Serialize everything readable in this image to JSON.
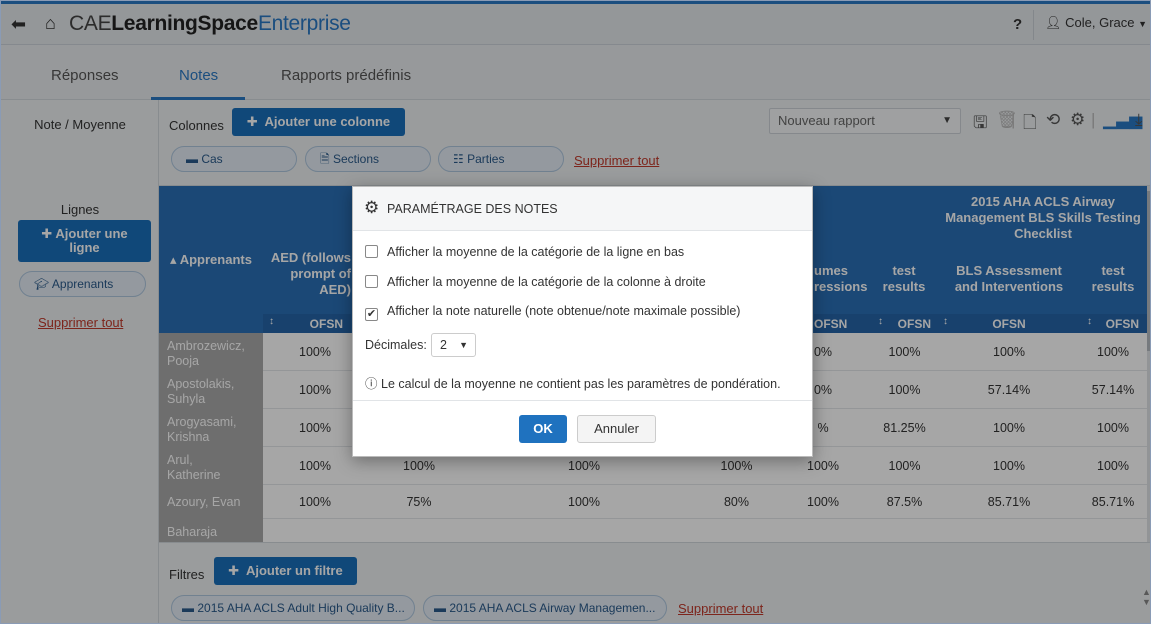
{
  "app": {
    "brand_part1": "CAE",
    "brand_part2": "LearningSpace",
    "brand_part3": "Enterprise",
    "help": "?",
    "user": "Cole, Grace"
  },
  "tabs": [
    {
      "label": "Réponses"
    },
    {
      "label": "Notes"
    },
    {
      "label": "Rapports prédéfinis"
    }
  ],
  "columns_area": {
    "side_label": "Note / Moyenne",
    "label": "Colonnes",
    "add_button": "Ajouter une colonne",
    "pills": [
      "Cas",
      "Sections",
      "Parties"
    ],
    "remove_all": "Supprimer tout",
    "report_select": "Nouveau rapport"
  },
  "rows_panel": {
    "title": "Lignes",
    "add_button_line1": "Ajouter une",
    "add_button_line2": "ligne",
    "pill": "Apprenants",
    "remove_all": "Supprimer tout"
  },
  "table": {
    "learners_header": "Apprenants",
    "col_aed_line1": "AED (follows",
    "col_aed_line2": "prompt of",
    "col_aed_line3": "AED)",
    "col_volumes_line1": "umes",
    "col_volumes_line2": "ressions",
    "col_test_line1": "test",
    "col_test_line2": "results",
    "group_title_line1": "2015 AHA ACLS Airway",
    "group_title_line2": "Management BLS Skills Testing",
    "group_title_line3": "Checklist",
    "col_bls_line1": "BLS Assessment",
    "col_bls_line2": "and Interventions",
    "col_test2_line1": "test",
    "col_test2_line2": "results",
    "sub_label": "OFSN",
    "sub_label_partial": "OFSN",
    "rows": [
      {
        "name1": "Ambrozewicz,",
        "name2": "Pooja",
        "c1": "100%",
        "c6": "0%",
        "c7": "100%",
        "c8": "100%",
        "c9": "100%"
      },
      {
        "name1": "Apostolakis,",
        "name2": "Suhyla",
        "c1": "100%",
        "c6": "0%",
        "c7": "100%",
        "c8": "57.14%",
        "c9": "57.14%"
      },
      {
        "name1": "Arogyasami,",
        "name2": "Krishna",
        "c1": "100%",
        "c6": "%",
        "c7": "81.25%",
        "c8": "100%",
        "c9": "100%"
      },
      {
        "name1": "Arul,",
        "name2": "Katherine",
        "c1": "100%",
        "c2": "100%",
        "c3": "100%",
        "c4": "100%",
        "c6": "100%",
        "c7": "100%",
        "c8": "100%",
        "c9": "100%"
      },
      {
        "name1": "Azoury, Evan",
        "name2": "",
        "c1": "100%",
        "c2": "75%",
        "c3": "100%",
        "c4": "80%",
        "c6": "100%",
        "c7": "87.5%",
        "c8": "85.71%",
        "c9": "85.71%"
      },
      {
        "name1": "Baharaja",
        "name2": ""
      }
    ]
  },
  "filters": {
    "label": "Filtres",
    "add_button": "Ajouter un filtre",
    "pills": [
      "2015 AHA ACLS Adult High Quality B...",
      "2015 AHA ACLS Airway Managemen..."
    ],
    "remove_all": "Supprimer tout"
  },
  "modal": {
    "title": "PARAMÉTRAGE DES NOTES",
    "opt1": "Afficher la moyenne de la catégorie de la ligne en bas",
    "opt2": "Afficher la moyenne de la catégorie de la colonne à droite",
    "opt3": "Afficher la note naturelle (note obtenue/note maximale possible)",
    "opt1_checked": false,
    "opt2_checked": false,
    "opt3_checked": true,
    "decimals_label": "Décimales:",
    "decimals_value": "2",
    "info": "Le calcul de la moyenne ne contient pas les paramètres de pondération.",
    "ok": "OK",
    "cancel": "Annuler"
  },
  "colors": {
    "accent": "#2a79c4",
    "header_blue": "#2a6fb5",
    "danger_link": "#c0392b"
  }
}
